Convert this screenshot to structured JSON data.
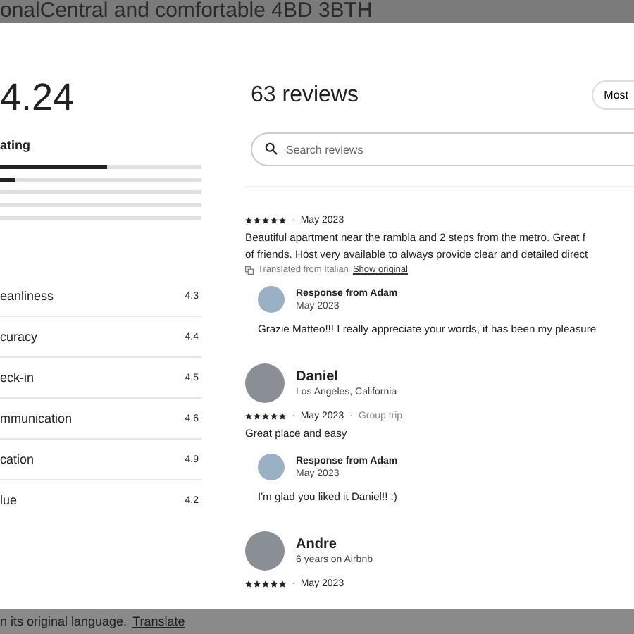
{
  "backdrop_title": "onalCentral and comfortable 4BD 3BTH",
  "rating": {
    "score": "4.24",
    "label": "ating",
    "bars": [
      {
        "level": 0.53
      },
      {
        "level": 0.08
      },
      {
        "level": 0
      },
      {
        "level": 0
      },
      {
        "level": 0
      }
    ],
    "categories": [
      {
        "name": "eanliness",
        "value": "4.3"
      },
      {
        "name": "curacy",
        "value": "4.4"
      },
      {
        "name": "eck-in",
        "value": "4.5"
      },
      {
        "name": "mmunication",
        "value": "4.6"
      },
      {
        "name": "cation",
        "value": "4.9"
      },
      {
        "name": "lue",
        "value": "4.2"
      }
    ]
  },
  "reviews_header": {
    "title": "63 reviews",
    "sort_button": "Most"
  },
  "search": {
    "placeholder": "Search reviews"
  },
  "reviews": [
    {
      "stars": 5,
      "separator": "·",
      "date": "May 2023",
      "lines": [
        "Beautiful apartment near the rambla and 2 steps from the metro. Great f",
        "of friends. Host very available to always provide clear and detailed direct"
      ],
      "translation": {
        "note": "Translated from Italian",
        "link": "Show original"
      },
      "response": {
        "title": "Response from Adam",
        "date": "May 2023",
        "text": "Grazie Matteo!!! I really appreciate your words, it has been my pleasure"
      }
    },
    {
      "name": "Daniel",
      "meta": "Los Angeles, California",
      "stars": 5,
      "separator": "·",
      "date": "May 2023",
      "trip_separator": "·",
      "trip": "Group trip",
      "lines": [
        "Great place and easy"
      ],
      "response": {
        "title": "Response from Adam",
        "date": "May 2023",
        "text": "I'm glad you liked it Daniel!! :)"
      }
    },
    {
      "name": "Andre",
      "meta": "6 years on Airbnb",
      "stars": 5,
      "separator": "·",
      "date": "May 2023"
    }
  ],
  "footer": {
    "text": "n its original language.",
    "link": "Translate"
  }
}
